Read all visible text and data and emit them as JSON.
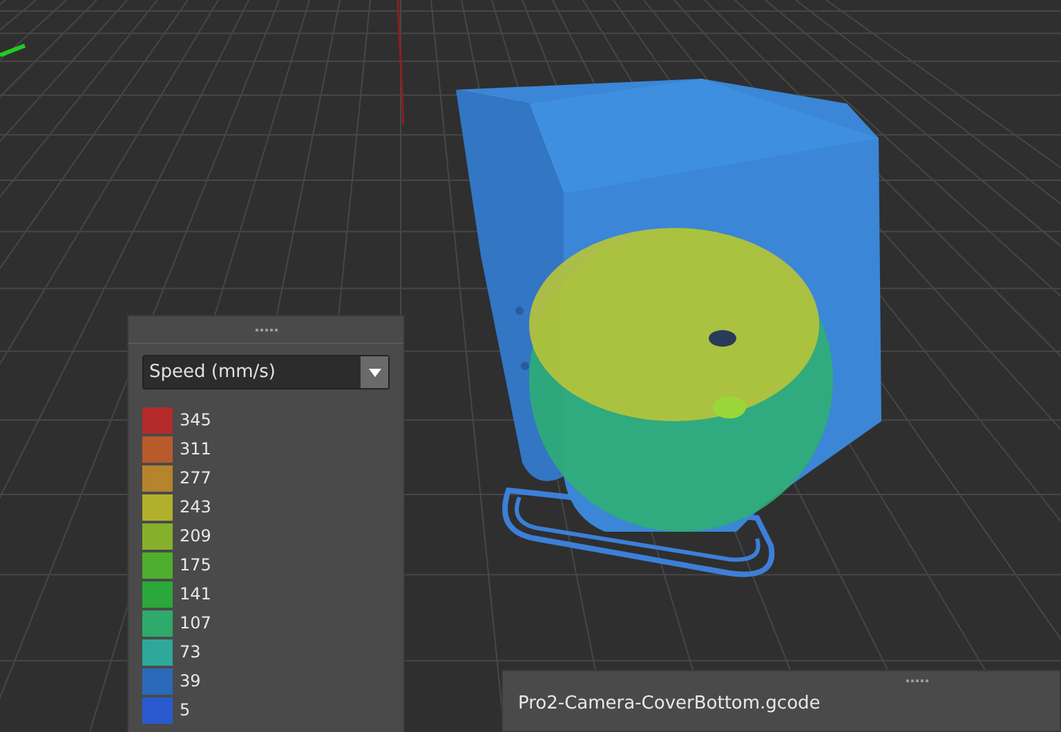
{
  "legend_panel": {
    "dropdown": {
      "value": "Speed (mm/s)"
    },
    "items": [
      {
        "label": "345",
        "color": "#b52a2a"
      },
      {
        "label": "311",
        "color": "#b85a2c"
      },
      {
        "label": "277",
        "color": "#b5842c"
      },
      {
        "label": "243",
        "color": "#b0b02c"
      },
      {
        "label": "209",
        "color": "#86b02c"
      },
      {
        "label": "175",
        "color": "#4eae2e"
      },
      {
        "label": "141",
        "color": "#2aa83a"
      },
      {
        "label": "107",
        "color": "#2eaa6a"
      },
      {
        "label": "73",
        "color": "#2ea89a"
      },
      {
        "label": "39",
        "color": "#2a6ab8"
      },
      {
        "label": "5",
        "color": "#2a5ad0"
      }
    ]
  },
  "file_panel": {
    "filename": "Pro2-Camera-CoverBottom.gcode"
  }
}
